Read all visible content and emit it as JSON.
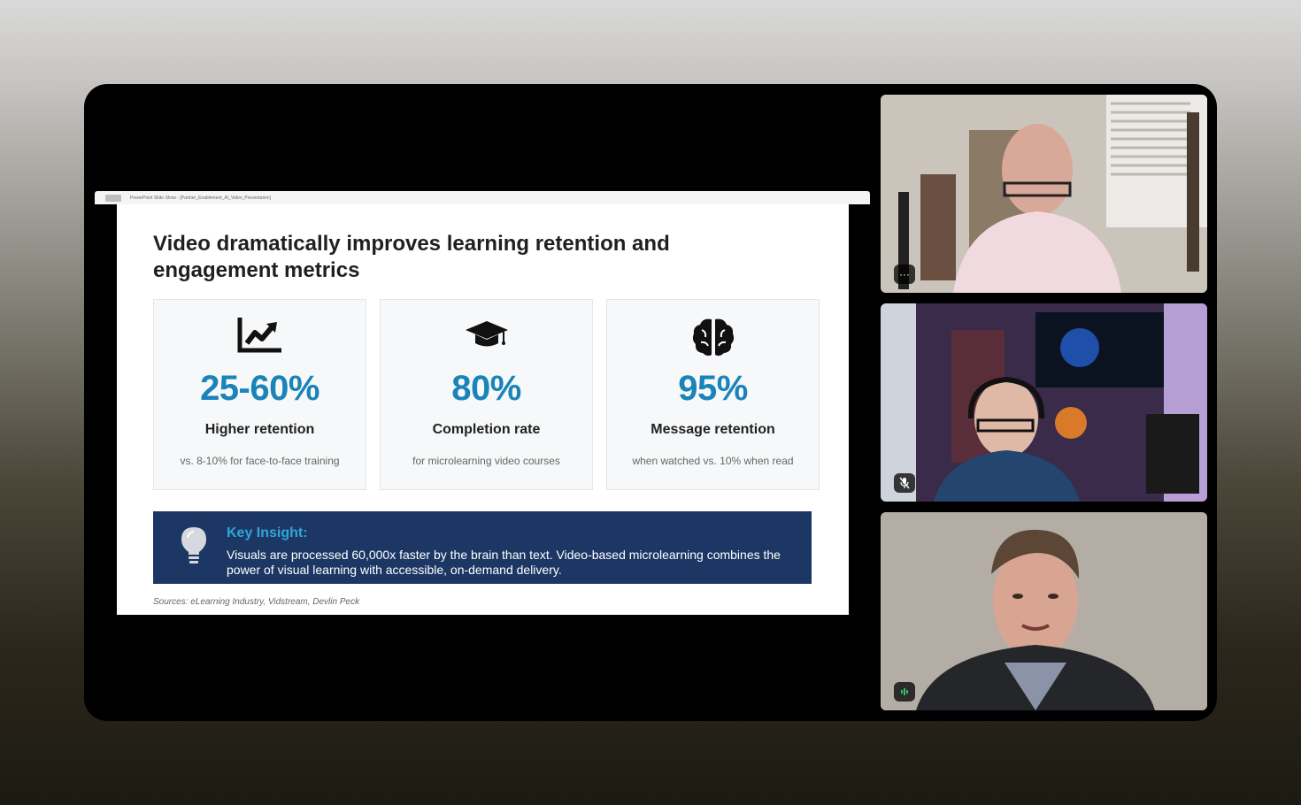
{
  "share": {
    "window_title": "PowerPoint Slide Show - [Partner_Enablement_AI_Video_Presentation]"
  },
  "slide": {
    "title": "Video dramatically improves learning retention and engagement metrics",
    "cards": [
      {
        "icon": "chart-line-icon",
        "value": "25-60%",
        "label": "Higher retention",
        "note": "vs. 8-10% for face-to-face training"
      },
      {
        "icon": "graduation-cap-icon",
        "value": "80%",
        "label": "Completion rate",
        "note": "for microlearning video courses"
      },
      {
        "icon": "brain-icon",
        "value": "95%",
        "label": "Message retention",
        "note": "when watched vs. 10% when read"
      }
    ],
    "insight": {
      "icon": "lightbulb-icon",
      "heading": "Key Insight:",
      "body": "Visuals are processed 60,000x faster by the brain than text. Video-based microlearning combines the power of visual learning with accessible, on-demand delivery."
    },
    "sources": "Sources: eLearning Industry, Vidstream, Devlin Peck"
  },
  "participants": [
    {
      "badge_icon": "more-options-icon",
      "badge": "···"
    },
    {
      "badge_icon": "mic-muted-icon",
      "badge": ""
    },
    {
      "badge_icon": "speaking-icon",
      "badge": ""
    }
  ],
  "colors": {
    "accent": "#1a84b8",
    "insight_bg": "#1d3764",
    "insight_heading": "#2fa6d9"
  }
}
